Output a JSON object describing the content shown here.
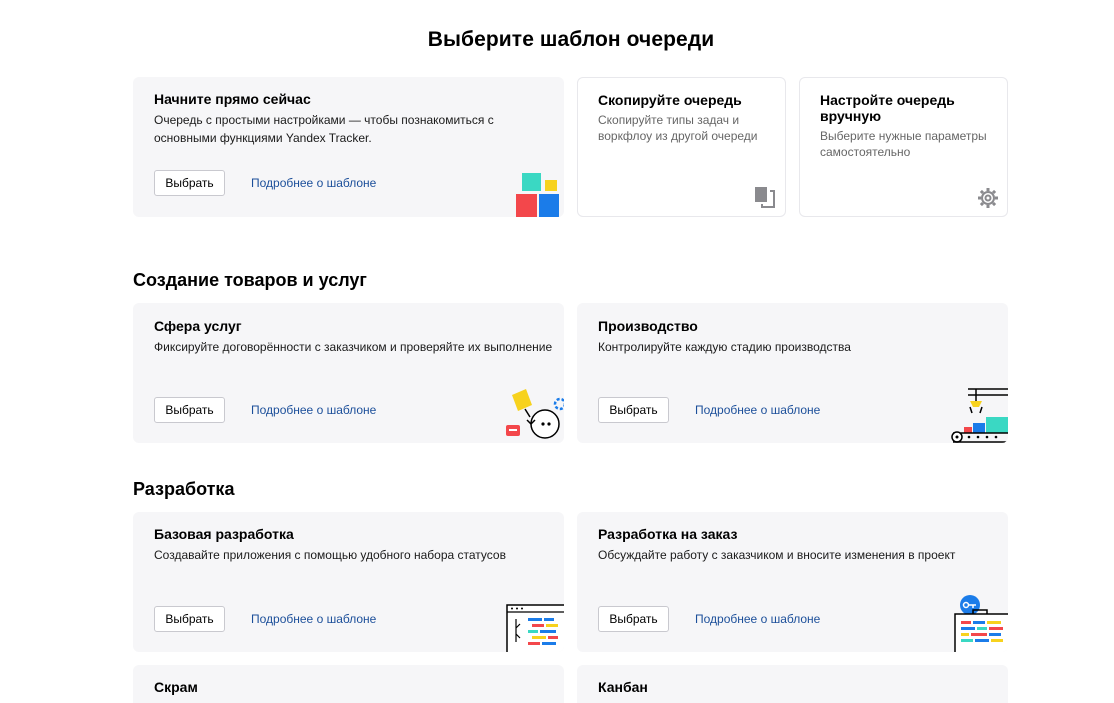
{
  "page_title": "Выберите шаблон очереди",
  "top_cards": {
    "quick_start": {
      "title": "Начните прямо сейчас",
      "description_line1": "Очередь с простыми настройками — чтобы познакомиться с",
      "description_line2": "основными функциями Yandex Tracker.",
      "button": "Выбрать",
      "link": "Подробнее о шаблоне"
    },
    "copy_queue": {
      "title": "Скопируйте очередь",
      "description_line1": "Скопируйте типы задач и",
      "description_line2": "воркфлоу из другой очереди",
      "icon": "copy-icon"
    },
    "manual_setup": {
      "title_line1": "Настройте очередь",
      "title_line2": "вручную",
      "description_line1": "Выберите нужные параметры",
      "description_line2": "самостоятельно",
      "icon": "gear-icon"
    }
  },
  "sections": {
    "products": {
      "title": "Создание товаров и услуг",
      "cards": [
        {
          "title": "Сфера услуг",
          "description": "Фиксируйте договорённости с заказчиком и проверяйте их выполнение",
          "button": "Выбрать",
          "link": "Подробнее о шаблоне"
        },
        {
          "title": "Производство",
          "description": "Контролируйте каждую стадию производства",
          "button": "Выбрать",
          "link": "Подробнее о шаблоне"
        }
      ]
    },
    "development": {
      "title": "Разработка",
      "cards": [
        {
          "title": "Базовая разработка",
          "description": "Создавайте приложения с помощью удобного набора статусов",
          "button": "Выбрать",
          "link": "Подробнее о шаблоне"
        },
        {
          "title": "Разработка на заказ",
          "description": "Обсуждайте работу с заказчиком и вносите изменения в проект",
          "button": "Выбрать",
          "link": "Подробнее о шаблоне"
        },
        {
          "title": "Скрам"
        },
        {
          "title": "Канбан"
        }
      ]
    }
  },
  "colors": {
    "link": "#1c4f9a",
    "card_bg": "#f6f6f8",
    "teal": "#3ad8c3",
    "yellow": "#f7d21e",
    "red": "#f3474b",
    "blue": "#1b7ce9"
  }
}
